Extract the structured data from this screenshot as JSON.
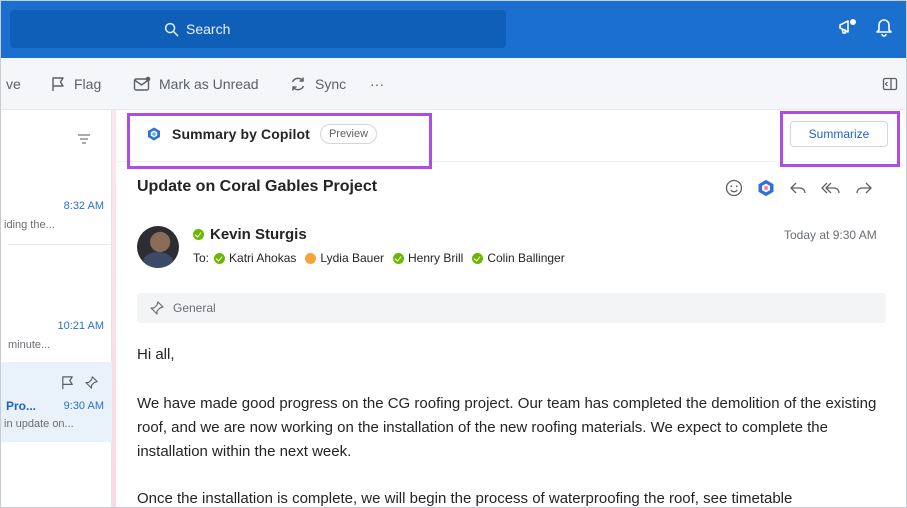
{
  "search": {
    "placeholder": "Search"
  },
  "toolbar": {
    "partial_label": "ve",
    "flag_label": "Flag",
    "mark_unread_label": "Mark as Unread",
    "sync_label": "Sync",
    "more_label": "···"
  },
  "message_list": {
    "items": [
      {
        "time": "8:32 AM",
        "preview": "iding the..."
      },
      {
        "time": "10:21 AM",
        "preview": "minute..."
      },
      {
        "sender_partial": "Pro...",
        "time": "9:30 AM",
        "preview": "in update on..."
      }
    ]
  },
  "copilot": {
    "title": "Summary by Copilot",
    "badge": "Preview",
    "summarize_label": "Summarize",
    "highlight_color": "#b04be6"
  },
  "email": {
    "subject": "Update on Coral Gables Project",
    "sender": "Kevin Sturgis",
    "received": "Today at 9:30 AM",
    "to_label": "To:",
    "recipients": [
      {
        "name": "Katri Ahokas",
        "status": "green"
      },
      {
        "name": "Lydia Bauer",
        "status": "orange"
      },
      {
        "name": "Henry Brill",
        "status": "green"
      },
      {
        "name": "Colin Ballinger",
        "status": "green"
      }
    ],
    "category": "General",
    "greeting": "Hi all,",
    "paragraph1": "We have made good progress on the CG roofing project. Our team has completed the demolition of the existing roof, and we are now working on the installation of the new roofing materials. We expect to complete the installation within the next week.",
    "paragraph2": "Once the installation is complete, we will begin the process of waterproofing the roof, see timetable"
  },
  "colors": {
    "header_blue": "#1a6fcf",
    "search_blue": "#0f5fb8",
    "link_blue": "#2a72c8",
    "presence_available": "#6bb700",
    "presence_away": "#f7a33a"
  },
  "icons": [
    "search-icon",
    "megaphone-icon",
    "bell-icon",
    "flag-icon",
    "mail-icon",
    "sync-icon",
    "more-icon",
    "reading-pane-icon",
    "filter-icon",
    "copilot-icon",
    "emoji-icon",
    "reply-icon",
    "reply-all-icon",
    "forward-icon",
    "tag-icon",
    "pin-icon"
  ]
}
